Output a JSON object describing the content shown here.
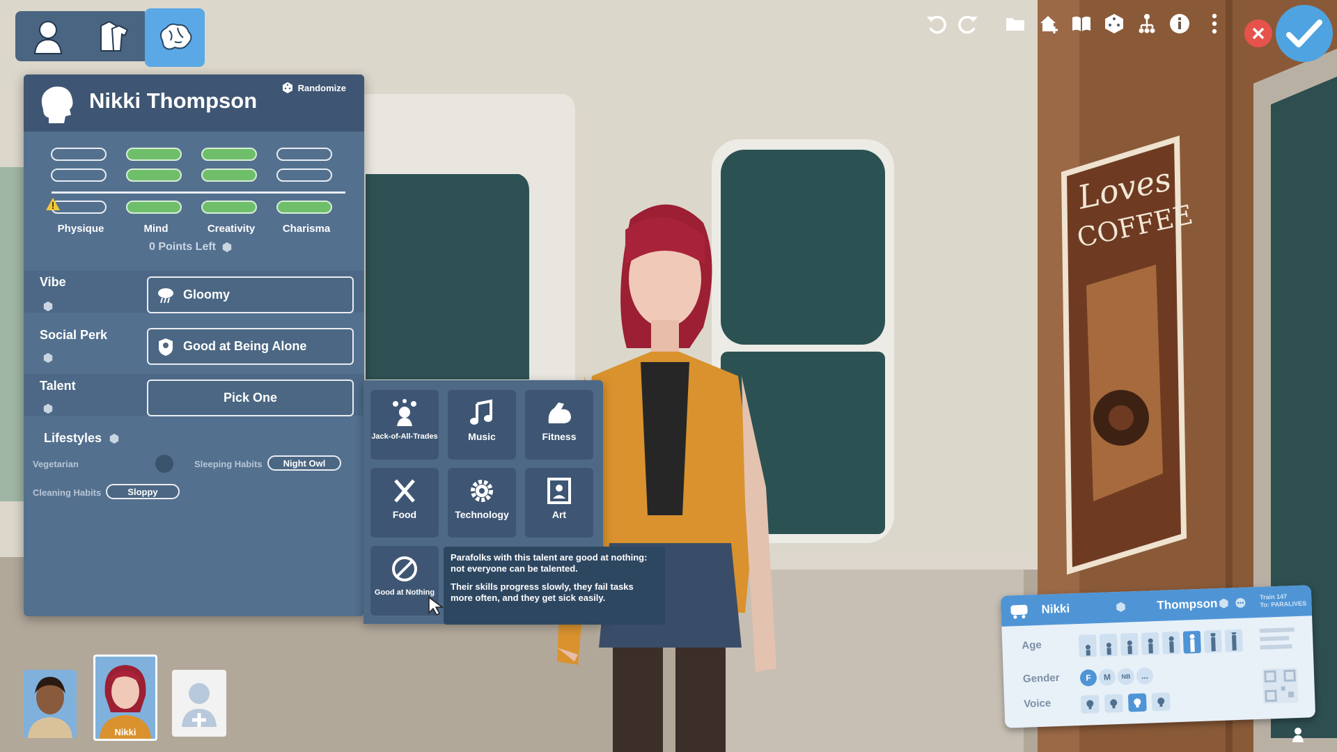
{
  "mode_tabs": [
    "body-tab",
    "clothes-tab",
    "personality-tab"
  ],
  "character": {
    "name": "Nikki Thompson",
    "randomize_label": "Randomize"
  },
  "stats": {
    "labels": [
      "Physique",
      "Mind",
      "Creativity",
      "Charisma"
    ],
    "levels": [
      0,
      3,
      3,
      1
    ],
    "points_left": "0 Points Left"
  },
  "traits": {
    "vibe": {
      "label": "Vibe",
      "value": "Gloomy"
    },
    "social_perk": {
      "label": "Social Perk",
      "value": "Good at Being Alone"
    },
    "talent": {
      "label": "Talent",
      "value": "Pick One"
    }
  },
  "lifestyles": {
    "title": "Lifestyles",
    "vegetarian_label": "Vegetarian",
    "sleeping_label": "Sleeping Habits",
    "sleeping_value": "Night Owl",
    "cleaning_label": "Cleaning Habits",
    "cleaning_value": "Sloppy"
  },
  "talents": [
    {
      "label": "Jack-of-All-Trades",
      "icon": "juggler-icon"
    },
    {
      "label": "Music",
      "icon": "music-note-icon"
    },
    {
      "label": "Fitness",
      "icon": "flexed-arm-icon"
    },
    {
      "label": "Food",
      "icon": "fork-knife-icon"
    },
    {
      "label": "Technology",
      "icon": "gear-icon"
    },
    {
      "label": "Art",
      "icon": "frame-icon"
    },
    {
      "label": "Good at Nothing",
      "icon": "prohibited-icon"
    }
  ],
  "tooltip": {
    "line1": "Parafolks with this talent are good at nothing: not everyone can be talented.",
    "line2": "Their skills progress slowly, they fail tasks more often, and they get sick easily."
  },
  "toolbar": [
    "undo-icon",
    "redo-icon",
    "folder-icon",
    "home-add-icon",
    "book-icon",
    "dice-icon",
    "family-tree-icon",
    "info-icon",
    "more-icon"
  ],
  "portraits": {
    "selected_name": "Nikki"
  },
  "ticket": {
    "first_name": "Nikki",
    "last_name": "Thompson",
    "train_line1": "Train 147",
    "train_line2": "To: PARALIVES",
    "age_label": "Age",
    "gender_label": "Gender",
    "voice_label": "Voice",
    "genders": [
      "F",
      "M",
      "NB",
      "..."
    ],
    "selected_gender": "F",
    "selected_age_index": 5,
    "selected_voice_index": 2
  },
  "poster_text": "Loves COFFEE",
  "colors": {
    "panel": "#54708f",
    "panel_head": "#3e5673",
    "accent": "#5aa8e6",
    "bar_on": "#6fbf6a",
    "close": "#e6534b"
  }
}
